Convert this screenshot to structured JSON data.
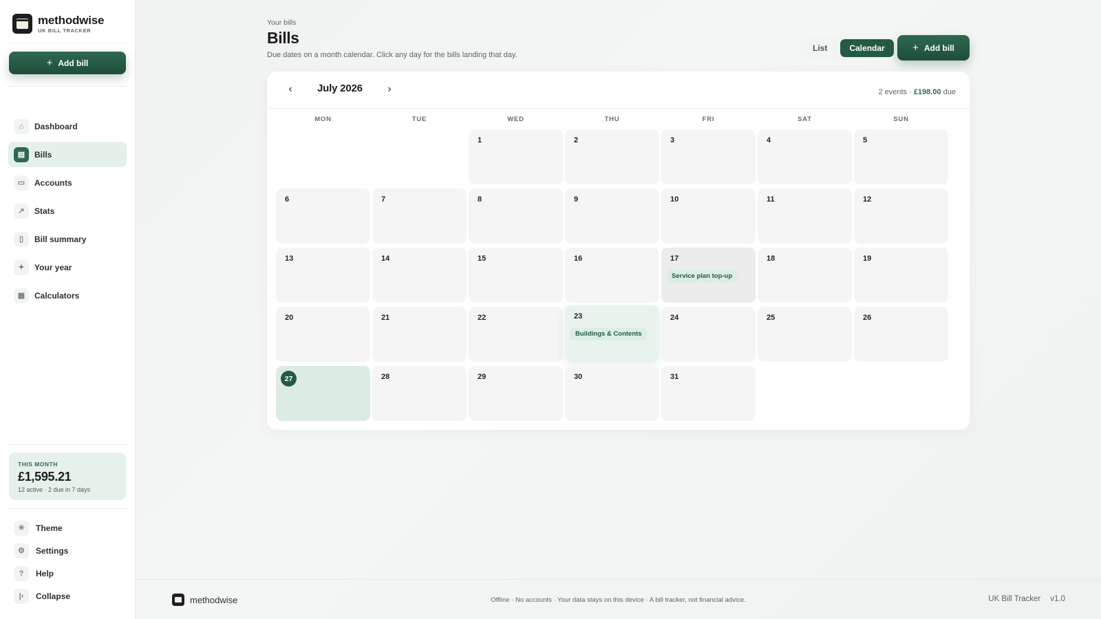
{
  "brand": {
    "name": "methodwise",
    "sub": "UK BILL TRACKER"
  },
  "sidebar": {
    "add_label": "Add bill",
    "items": [
      {
        "label": "Dashboard",
        "icon": "home-icon"
      },
      {
        "label": "Bills",
        "icon": "receipt-icon",
        "active": true
      },
      {
        "label": "Accounts",
        "icon": "wallet-icon"
      },
      {
        "label": "Stats",
        "icon": "trend-icon"
      },
      {
        "label": "Bill summary",
        "icon": "document-icon"
      },
      {
        "label": "Your year",
        "icon": "sparkle-icon"
      },
      {
        "label": "Calculators",
        "icon": "calculator-icon"
      }
    ],
    "month_card": {
      "label": "THIS MONTH",
      "amount": "£1,595.21",
      "sub": "12 active · 2 due in 7 days"
    },
    "bottom": [
      {
        "label": "Theme",
        "icon": "sun-icon"
      },
      {
        "label": "Settings",
        "icon": "gear-icon"
      },
      {
        "label": "Help",
        "icon": "help-icon"
      },
      {
        "label": "Collapse",
        "icon": "collapse-icon"
      }
    ]
  },
  "header": {
    "kicker": "Your bills",
    "title": "Bills",
    "desc": "Due dates on a month calendar. Click any day for the bills landing that day.",
    "view_list": "List",
    "view_calendar": "Calendar",
    "add_label": "Add bill"
  },
  "calendar": {
    "month": "July 2026",
    "summary_prefix": "2 events · ",
    "summary_amount": "£198.00",
    "summary_suffix": " due",
    "weekdays": [
      "MON",
      "TUE",
      "WED",
      "THU",
      "FRI",
      "SAT",
      "SUN"
    ],
    "first_weekday_index": 2,
    "days_in_month": 31,
    "today": 27,
    "events": [
      {
        "day": 17,
        "label": "Service plan top-up"
      },
      {
        "day": 23,
        "label": "Buildings & Contents"
      }
    ]
  },
  "footer": {
    "name": "methodwise",
    "note": "Offline · No accounts · Your data stays on this device · A bill tracker, not financial advice.",
    "product": "UK Bill Tracker",
    "version": "v1.0"
  }
}
